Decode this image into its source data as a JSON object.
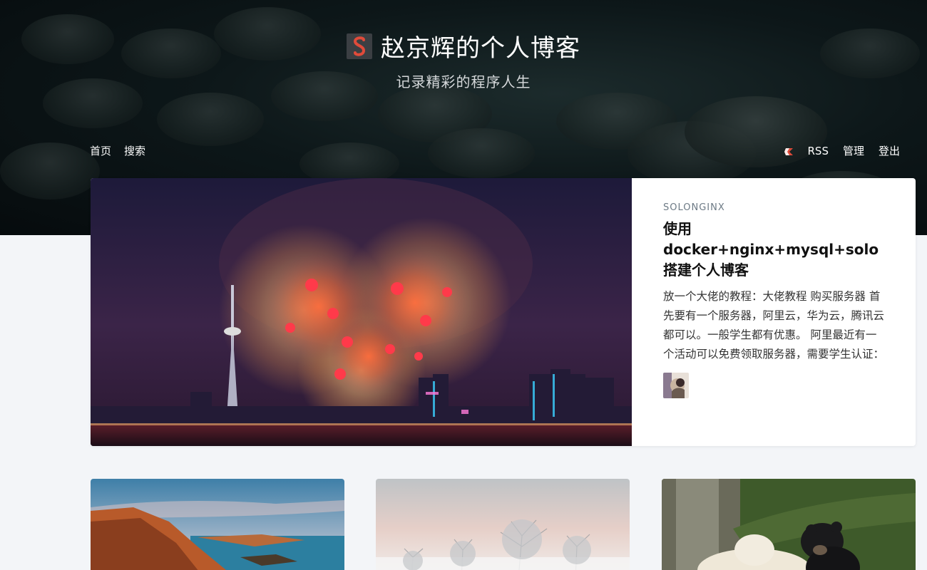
{
  "site": {
    "title": "赵京辉的个人博客",
    "subtitle": "记录精彩的程序人生",
    "logo_letter": "S"
  },
  "nav": {
    "left": [
      {
        "label": "首页"
      },
      {
        "label": "搜索"
      }
    ],
    "right": [
      {
        "label": "RSS"
      },
      {
        "label": "管理"
      },
      {
        "label": "登出"
      }
    ]
  },
  "featured": {
    "tag": "SOLONGINX",
    "title": "使用docker+nginx+mysql+solo搭建个人博客",
    "excerpt": "放一个大佬的教程：大佬教程 购买服务器 首先要有一个服务器，阿里云，华为云，腾讯云都可以。一般学生都有优惠。 阿里最近有一个活动可以免费领取服务器，需要学生认证："
  },
  "colors": {
    "accent": "#e04b3a",
    "page_bg": "#f3f5f8",
    "hero_bg": "#0d1719"
  },
  "icons": {
    "brand": "solo-logo-icon",
    "nav_logo": "solo-mark-icon"
  }
}
